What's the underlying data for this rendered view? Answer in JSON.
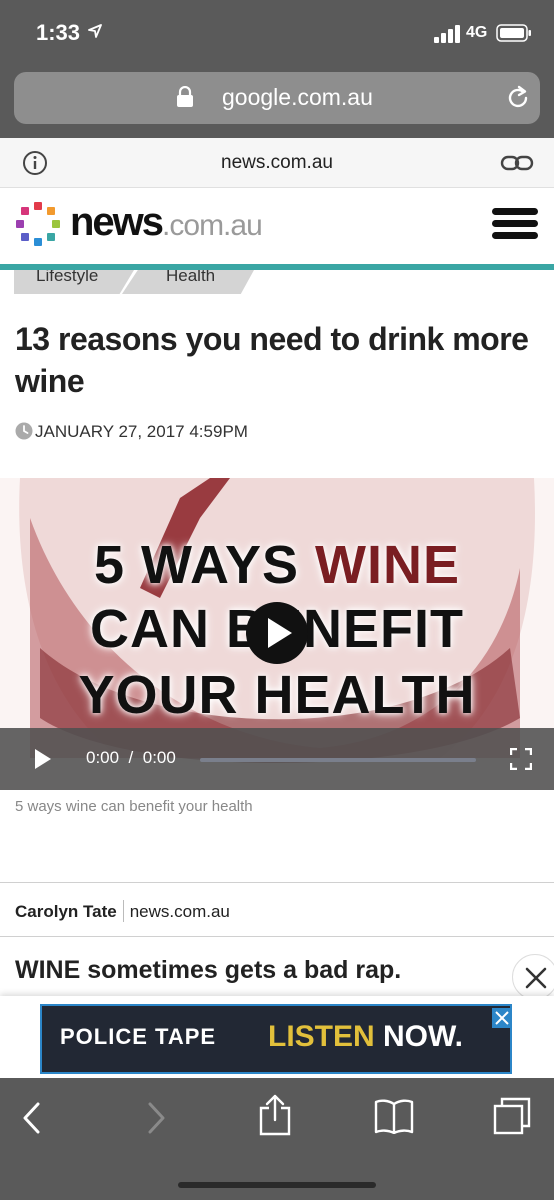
{
  "status_bar": {
    "time": "1:33",
    "network": "4G",
    "icons": [
      "location-arrow-icon",
      "signal-icon",
      "battery-icon"
    ]
  },
  "browser": {
    "url": "google.com.au",
    "icons": [
      "lock-icon",
      "reload-icon"
    ]
  },
  "amp_header": {
    "site": "news.com.au",
    "icons": [
      "info-icon",
      "link-icon"
    ]
  },
  "masthead": {
    "logo_word": "news",
    "logo_domain": ".com.au",
    "menu_icon": "hamburger-icon",
    "accent_color": "#3aa6a4"
  },
  "breadcrumbs": [
    {
      "label": "Lifestyle"
    },
    {
      "label": "Health"
    }
  ],
  "article": {
    "headline": "13 reasons you need to drink more wine",
    "date": "JANUARY 27, 2017 4:59PM",
    "video": {
      "title_line1_a": "5 WAYS ",
      "title_line1_b": "WINE",
      "title_line2": "CAN BENEFIT",
      "title_line3": "YOUR HEALTH",
      "current_time": "0:00",
      "separator": "/",
      "duration": "0:00"
    },
    "caption": "5 ways wine can benefit your health",
    "author": "Carolyn Tate",
    "source": "news.com.au",
    "lede": "WINE sometimes gets a bad rap."
  },
  "ad": {
    "left_text": "POLICE TAPE",
    "cta_a": "LISTEN",
    "cta_b": "NOW."
  },
  "toolbar": {
    "icons": [
      "back-icon",
      "forward-icon",
      "share-icon",
      "bookmarks-icon",
      "tabs-icon"
    ]
  }
}
